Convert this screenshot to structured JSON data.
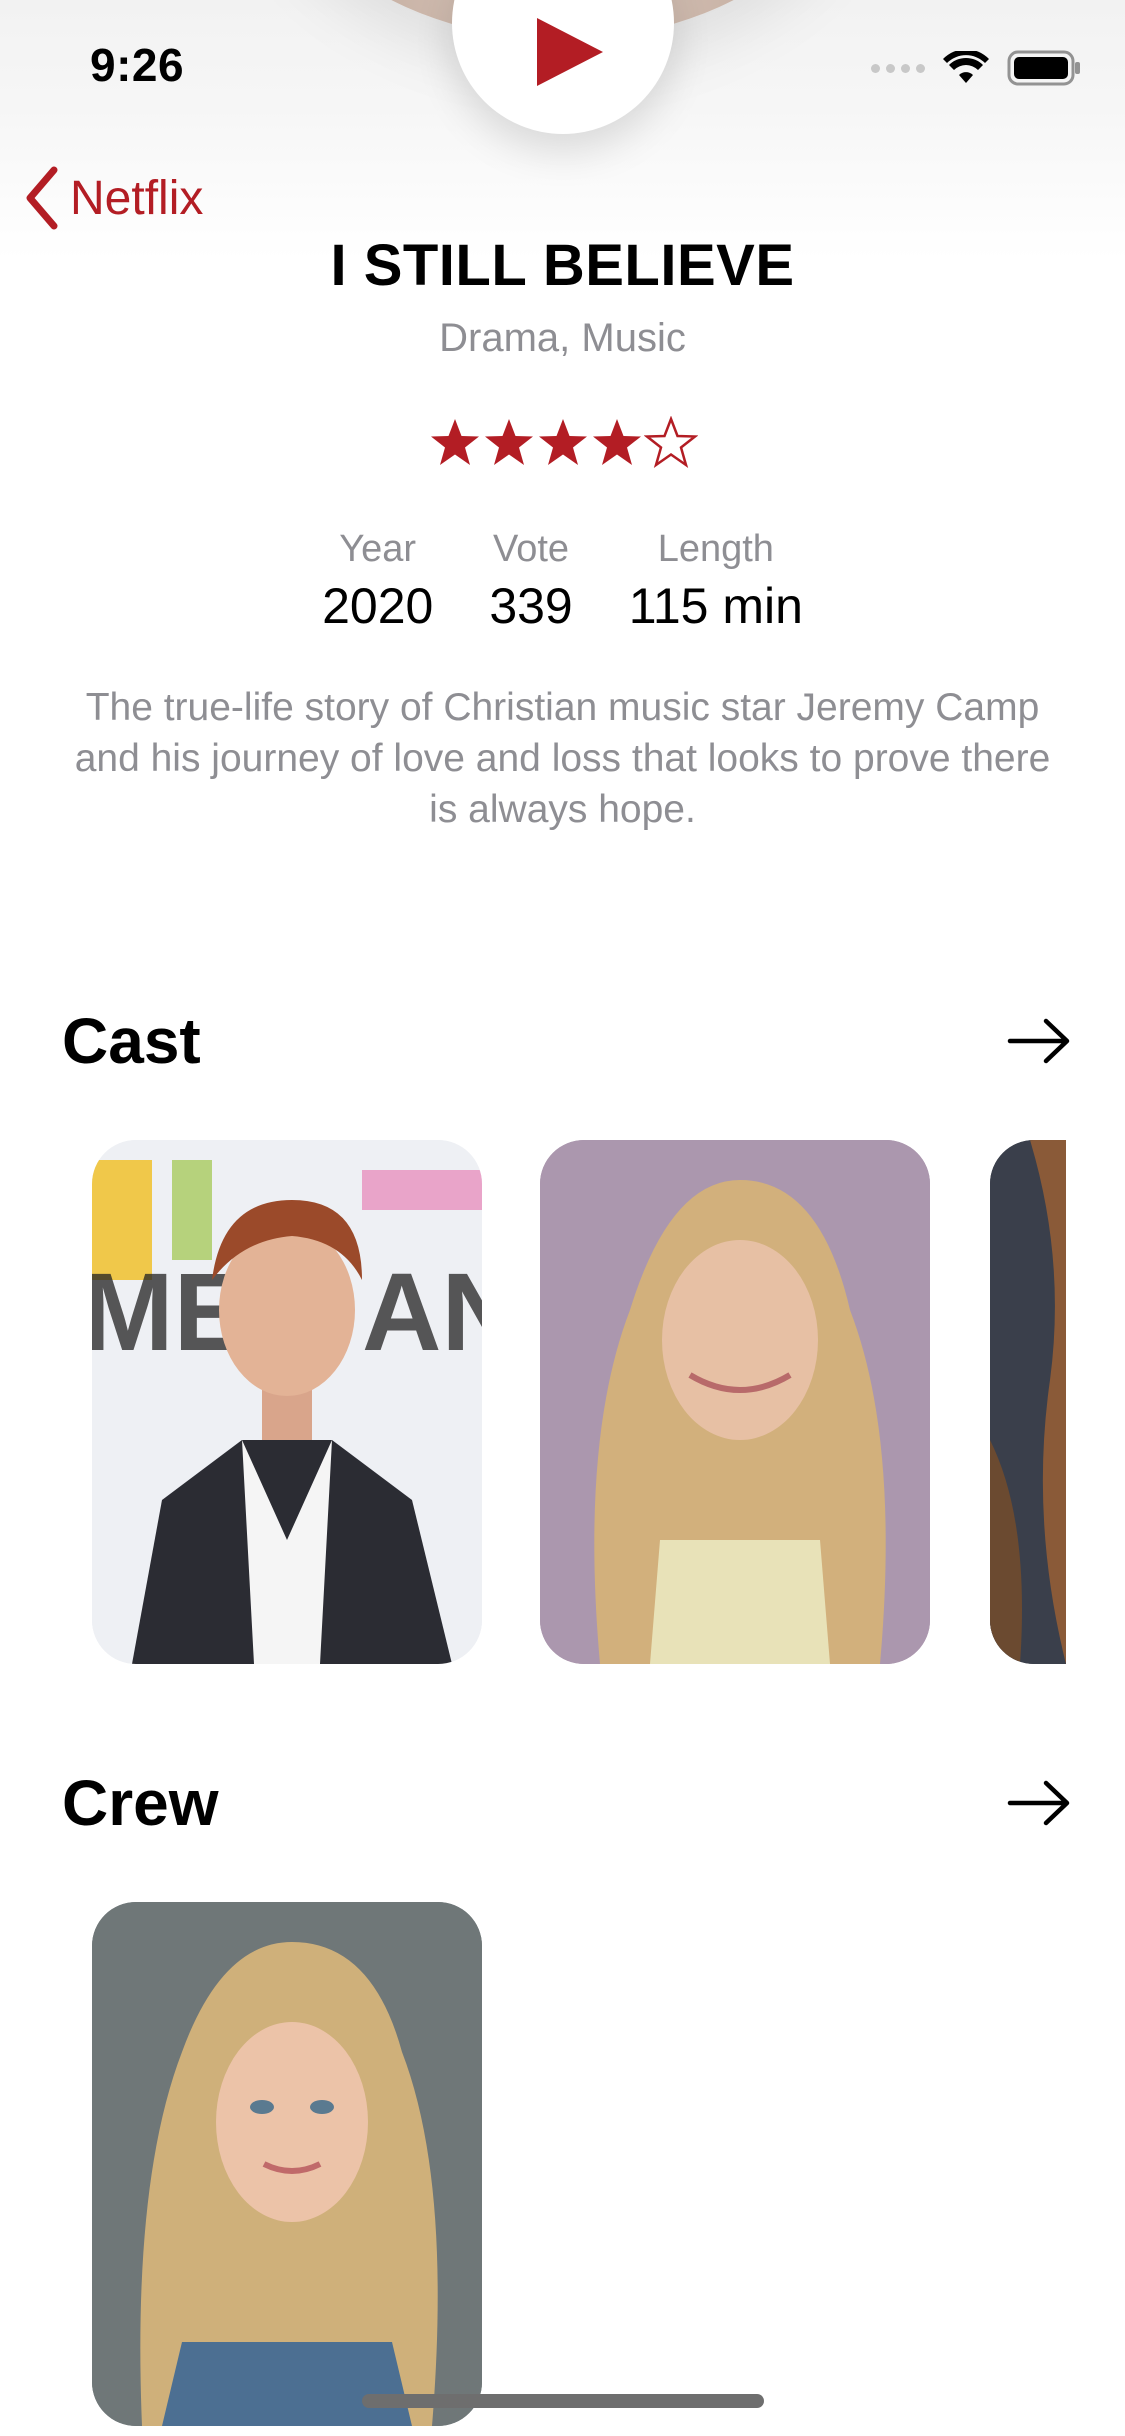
{
  "status_bar": {
    "time": "9:26"
  },
  "nav": {
    "back_label": "Netflix",
    "accent_color": "#b31d24"
  },
  "movie": {
    "title": "I STILL BELIEVE",
    "genres": "Drama, Music",
    "rating": {
      "filled_stars": 4,
      "total_stars": 5
    },
    "stats": [
      {
        "label": "Year",
        "value": "2020"
      },
      {
        "label": "Vote",
        "value": "339"
      },
      {
        "label": "Length",
        "value": "115 min"
      }
    ],
    "overview": "The true-life story of Christian music star Jeremy Camp and his journey of love and loss that looks to prove there is always hope."
  },
  "sections": {
    "cast": {
      "title": "Cast"
    },
    "crew": {
      "title": "Crew"
    }
  },
  "icons": {
    "play": "play-icon",
    "back": "chevron-left-icon",
    "arrow": "arrow-right-icon",
    "wifi": "wifi-icon",
    "battery": "battery-icon",
    "signal": "signal-icon",
    "star_filled": "star-filled-icon",
    "star_empty": "star-outline-icon"
  }
}
